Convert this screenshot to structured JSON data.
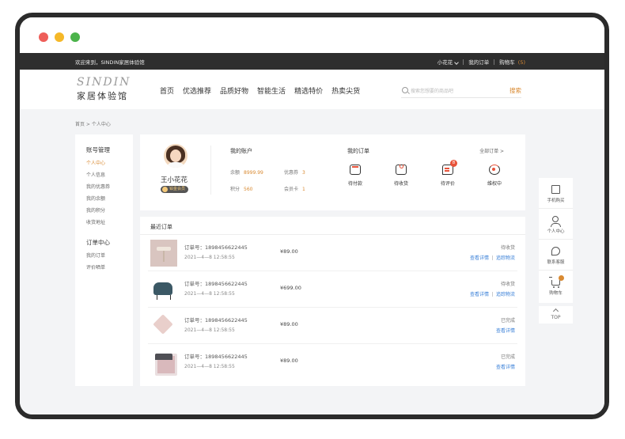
{
  "topbar": {
    "welcome": "欢迎来到，SINDIN家居体验馆",
    "username": "小花花",
    "my_orders": "我的订单",
    "cart": "购物车",
    "cart_count": "(5)"
  },
  "logo": {
    "en": "SINDIN",
    "cn": "家居体验馆"
  },
  "nav": [
    "首页",
    "优选推荐",
    "品质好物",
    "智能生活",
    "精选特价",
    "热卖尖货"
  ],
  "search": {
    "placeholder": "搜索您想要的商品吧",
    "button": "搜索"
  },
  "breadcrumb": "首页 > 个人中心",
  "sidebar": {
    "group1": {
      "title": "账号管理",
      "items": [
        "个人中心",
        "个人信息",
        "我的优惠券",
        "我的余额",
        "我的积分",
        "收货地址"
      ]
    },
    "group2": {
      "title": "订单中心",
      "items": [
        "我的订单",
        "评价晒单"
      ]
    }
  },
  "profile": {
    "name": "王小花花",
    "badge": "铂金会员"
  },
  "account": {
    "title": "我的账户",
    "balance_label": "余额",
    "balance": "8999.99",
    "coupon_label": "优惠券",
    "coupon": "3",
    "points_label": "积分",
    "points": "560",
    "card_label": "会员卡",
    "card": "1"
  },
  "my_orders": {
    "title": "我的订单",
    "all": "全部订单 >",
    "items": [
      {
        "label": "待付款",
        "icon": "wallet-icon"
      },
      {
        "label": "待收货",
        "icon": "package-icon"
      },
      {
        "label": "待评价",
        "icon": "comment-icon",
        "badge": "8"
      },
      {
        "label": "维权中",
        "icon": "refund-icon"
      }
    ]
  },
  "recent": {
    "title": "最近订单",
    "orders": [
      {
        "no": "订单号：1898456622445",
        "date": "2021—4—8 12:58:55",
        "price": "¥89.00",
        "status": "待收货",
        "links": [
          "查看详情",
          "追踪物流"
        ]
      },
      {
        "no": "订单号：1898456622445",
        "date": "2021—4—8 12:58:55",
        "price": "¥699.00",
        "status": "待收货",
        "links": [
          "查看详情",
          "追踪物流"
        ]
      },
      {
        "no": "订单号：1898456622445",
        "date": "2021—4—8 12:58:55",
        "price": "¥89.00",
        "status": "已完成",
        "links": [
          "查看详情"
        ]
      },
      {
        "no": "订单号：1898456622445",
        "date": "2021—4—8 12:58:55",
        "price": "¥89.00",
        "status": "已完成",
        "links": [
          "查看详情"
        ]
      }
    ]
  },
  "float_bar": [
    {
      "label": "手机购买",
      "icon": "qr-icon"
    },
    {
      "label": "个人中心",
      "icon": "user-icon"
    },
    {
      "label": "联系客服",
      "icon": "chat-icon"
    },
    {
      "label": "购物车",
      "icon": "cart-icon"
    }
  ],
  "top": "TOP",
  "colors": {
    "accent": "#d98a32",
    "link": "#3c82d8",
    "alert": "#e8533a",
    "topbar": "#2e2e2e"
  }
}
